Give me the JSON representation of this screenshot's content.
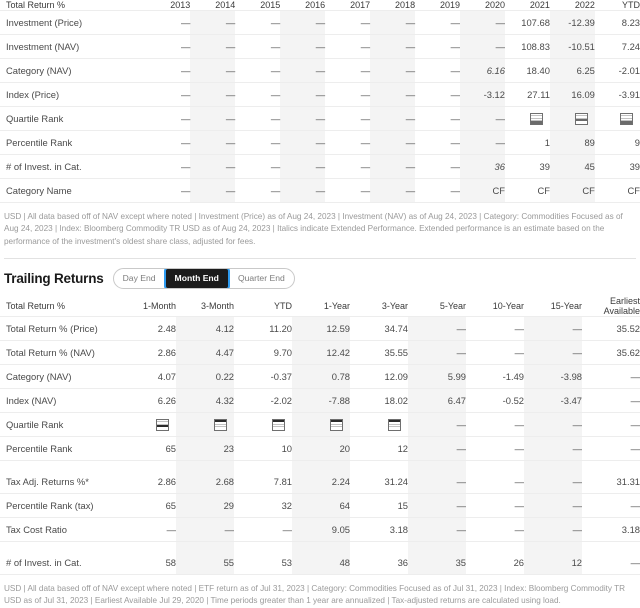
{
  "annual": {
    "label_header": "Total Return %",
    "columns": [
      "2013",
      "2014",
      "2015",
      "2016",
      "2017",
      "2018",
      "2019",
      "2020",
      "2021",
      "2022",
      "YTD"
    ],
    "rows": [
      {
        "label": "Investment (Price)",
        "values": [
          "—",
          "—",
          "—",
          "—",
          "—",
          "—",
          "—",
          "—",
          "107.68",
          "-12.39",
          "8.23"
        ],
        "type": "text"
      },
      {
        "label": "Investment (NAV)",
        "values": [
          "—",
          "—",
          "—",
          "—",
          "—",
          "—",
          "—",
          "—",
          "108.83",
          "-10.51",
          "7.24"
        ],
        "type": "text"
      },
      {
        "label": "Category (NAV)",
        "values": [
          "—",
          "—",
          "—",
          "—",
          "—",
          "—",
          "—",
          "6.16",
          "18.40",
          "6.25",
          "-2.01"
        ],
        "type": "text",
        "italic_index": [
          7
        ]
      },
      {
        "label": "Index (Price)",
        "values": [
          "—",
          "—",
          "—",
          "—",
          "—",
          "—",
          "—",
          "-3.12",
          "27.11",
          "16.09",
          "-3.91"
        ],
        "type": "text"
      },
      {
        "label": "Quartile Rank",
        "values": [
          "—",
          "—",
          "—",
          "—",
          "—",
          "—",
          "—",
          "—",
          "q4",
          "q3",
          "q4"
        ],
        "type": "quartile"
      },
      {
        "label": "Percentile Rank",
        "values": [
          "—",
          "—",
          "—",
          "—",
          "—",
          "—",
          "—",
          "—",
          "1",
          "89",
          "9"
        ],
        "type": "text"
      },
      {
        "label": "# of Invest. in Cat.",
        "values": [
          "—",
          "—",
          "—",
          "—",
          "—",
          "—",
          "—",
          "36",
          "39",
          "45",
          "39"
        ],
        "type": "text",
        "italic_index": [
          7
        ]
      },
      {
        "label": "Category Name",
        "values": [
          "—",
          "—",
          "—",
          "—",
          "—",
          "—",
          "—",
          "CF",
          "CF",
          "CF",
          "CF"
        ],
        "type": "text"
      }
    ],
    "footnote": "USD | All data based off of NAV except where noted | Investment (Price) as of Aug 24, 2023 | Investment (NAV) as of Aug 24, 2023 | Category: Commodities Focused as of Aug 24, 2023 | Index: Bloomberg Commodity TR USD as of Aug 24, 2023 | Italics indicate Extended Performance. Extended performance is an estimate based on the performance of the investment's oldest share class, adjusted for fees."
  },
  "trailing": {
    "title": "Trailing Returns",
    "tabs": [
      {
        "label": "Day End",
        "active": false
      },
      {
        "label": "Month End",
        "active": true
      },
      {
        "label": "Quarter End",
        "active": false
      }
    ],
    "label_header": "Total Return %",
    "columns": [
      "1-Month",
      "3-Month",
      "YTD",
      "1-Year",
      "3-Year",
      "5-Year",
      "10-Year",
      "15-Year",
      "Earliest\nAvailable"
    ],
    "rows": [
      {
        "label": "Total Return % (Price)",
        "values": [
          "2.48",
          "4.12",
          "11.20",
          "12.59",
          "34.74",
          "—",
          "—",
          "—",
          "35.52"
        ],
        "type": "text"
      },
      {
        "label": "Total Return % (NAV)",
        "values": [
          "2.86",
          "4.47",
          "9.70",
          "12.42",
          "35.55",
          "—",
          "—",
          "—",
          "35.62"
        ],
        "type": "text"
      },
      {
        "label": "Category (NAV)",
        "values": [
          "4.07",
          "0.22",
          "-0.37",
          "0.78",
          "12.09",
          "5.99",
          "-1.49",
          "-3.98",
          "—"
        ],
        "type": "text"
      },
      {
        "label": "Index (NAV)",
        "values": [
          "6.26",
          "4.32",
          "-2.02",
          "-7.88",
          "18.02",
          "6.47",
          "-0.52",
          "-3.47",
          "—"
        ],
        "type": "text"
      },
      {
        "label": "Quartile Rank",
        "values": [
          "q3",
          "q1",
          "q1",
          "q1",
          "q1",
          "—",
          "—",
          "—",
          "—"
        ],
        "type": "quartile"
      },
      {
        "label": "Percentile Rank",
        "values": [
          "65",
          "23",
          "10",
          "20",
          "12",
          "—",
          "—",
          "—",
          "—"
        ],
        "type": "text"
      },
      {
        "label": "Tax Adj. Returns %*",
        "values": [
          "2.86",
          "2.68",
          "7.81",
          "2.24",
          "31.24",
          "—",
          "—",
          "—",
          "31.31"
        ],
        "type": "text",
        "gap_before": true
      },
      {
        "label": "Percentile Rank (tax)",
        "values": [
          "65",
          "29",
          "32",
          "64",
          "15",
          "—",
          "—",
          "—",
          "—"
        ],
        "type": "text"
      },
      {
        "label": "Tax Cost Ratio",
        "values": [
          "—",
          "—",
          "—",
          "9.05",
          "3.18",
          "—",
          "—",
          "—",
          "3.18"
        ],
        "type": "text"
      },
      {
        "label": "# of Invest. in Cat.",
        "values": [
          "58",
          "55",
          "53",
          "48",
          "36",
          "35",
          "26",
          "12",
          "—"
        ],
        "type": "text",
        "gap_before": true
      }
    ],
    "footnote": "USD | All data based off of NAV except where noted | ETF return as of Jul 31, 2023 | Category: Commodities Focused as of Jul 31, 2023 | Index: Bloomberg Commodity TR USD as of Jul 31, 2023 | Earliest Available Jul 29, 2020 | Time periods greater than 1 year are annualized | Tax-adjusted returns are calculated using load."
  },
  "colors": {
    "accent": "#2e9bf0",
    "tab_active_bg": "#1c1c1c",
    "shaded_column": "#f4f4f4",
    "text": "#4a4a4a",
    "muted": "#9a9a9a"
  }
}
